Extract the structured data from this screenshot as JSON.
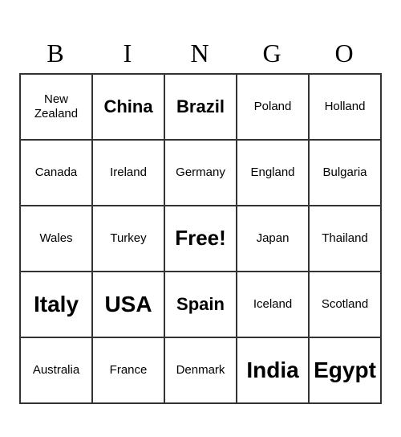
{
  "header": {
    "letters": [
      "B",
      "I",
      "N",
      "G",
      "O"
    ]
  },
  "grid": [
    [
      {
        "text": "New Zealand",
        "size": "normal"
      },
      {
        "text": "China",
        "size": "large"
      },
      {
        "text": "Brazil",
        "size": "large"
      },
      {
        "text": "Poland",
        "size": "normal"
      },
      {
        "text": "Holland",
        "size": "normal"
      }
    ],
    [
      {
        "text": "Canada",
        "size": "normal"
      },
      {
        "text": "Ireland",
        "size": "normal"
      },
      {
        "text": "Germany",
        "size": "normal"
      },
      {
        "text": "England",
        "size": "normal"
      },
      {
        "text": "Bulgaria",
        "size": "normal"
      }
    ],
    [
      {
        "text": "Wales",
        "size": "normal"
      },
      {
        "text": "Turkey",
        "size": "normal"
      },
      {
        "text": "Free!",
        "size": "free"
      },
      {
        "text": "Japan",
        "size": "normal"
      },
      {
        "text": "Thailand",
        "size": "normal"
      }
    ],
    [
      {
        "text": "Italy",
        "size": "xlarge"
      },
      {
        "text": "USA",
        "size": "xlarge"
      },
      {
        "text": "Spain",
        "size": "large"
      },
      {
        "text": "Iceland",
        "size": "normal"
      },
      {
        "text": "Scotland",
        "size": "normal"
      }
    ],
    [
      {
        "text": "Australia",
        "size": "normal"
      },
      {
        "text": "France",
        "size": "normal"
      },
      {
        "text": "Denmark",
        "size": "normal"
      },
      {
        "text": "India",
        "size": "xlarge"
      },
      {
        "text": "Egypt",
        "size": "xlarge"
      }
    ]
  ]
}
